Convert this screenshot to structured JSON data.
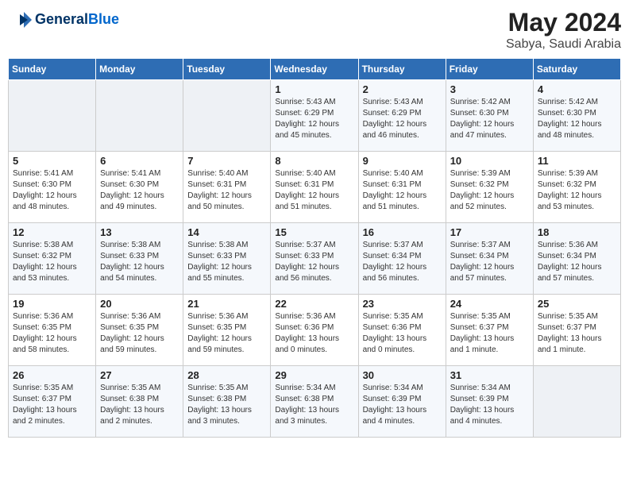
{
  "header": {
    "logo_line1": "General",
    "logo_line2": "Blue",
    "month_year": "May 2024",
    "location": "Sabya, Saudi Arabia"
  },
  "days_of_week": [
    "Sunday",
    "Monday",
    "Tuesday",
    "Wednesday",
    "Thursday",
    "Friday",
    "Saturday"
  ],
  "weeks": [
    [
      {
        "day": "",
        "info": ""
      },
      {
        "day": "",
        "info": ""
      },
      {
        "day": "",
        "info": ""
      },
      {
        "day": "1",
        "info": "Sunrise: 5:43 AM\nSunset: 6:29 PM\nDaylight: 12 hours\nand 45 minutes."
      },
      {
        "day": "2",
        "info": "Sunrise: 5:43 AM\nSunset: 6:29 PM\nDaylight: 12 hours\nand 46 minutes."
      },
      {
        "day": "3",
        "info": "Sunrise: 5:42 AM\nSunset: 6:30 PM\nDaylight: 12 hours\nand 47 minutes."
      },
      {
        "day": "4",
        "info": "Sunrise: 5:42 AM\nSunset: 6:30 PM\nDaylight: 12 hours\nand 48 minutes."
      }
    ],
    [
      {
        "day": "5",
        "info": "Sunrise: 5:41 AM\nSunset: 6:30 PM\nDaylight: 12 hours\nand 48 minutes."
      },
      {
        "day": "6",
        "info": "Sunrise: 5:41 AM\nSunset: 6:30 PM\nDaylight: 12 hours\nand 49 minutes."
      },
      {
        "day": "7",
        "info": "Sunrise: 5:40 AM\nSunset: 6:31 PM\nDaylight: 12 hours\nand 50 minutes."
      },
      {
        "day": "8",
        "info": "Sunrise: 5:40 AM\nSunset: 6:31 PM\nDaylight: 12 hours\nand 51 minutes."
      },
      {
        "day": "9",
        "info": "Sunrise: 5:40 AM\nSunset: 6:31 PM\nDaylight: 12 hours\nand 51 minutes."
      },
      {
        "day": "10",
        "info": "Sunrise: 5:39 AM\nSunset: 6:32 PM\nDaylight: 12 hours\nand 52 minutes."
      },
      {
        "day": "11",
        "info": "Sunrise: 5:39 AM\nSunset: 6:32 PM\nDaylight: 12 hours\nand 53 minutes."
      }
    ],
    [
      {
        "day": "12",
        "info": "Sunrise: 5:38 AM\nSunset: 6:32 PM\nDaylight: 12 hours\nand 53 minutes."
      },
      {
        "day": "13",
        "info": "Sunrise: 5:38 AM\nSunset: 6:33 PM\nDaylight: 12 hours\nand 54 minutes."
      },
      {
        "day": "14",
        "info": "Sunrise: 5:38 AM\nSunset: 6:33 PM\nDaylight: 12 hours\nand 55 minutes."
      },
      {
        "day": "15",
        "info": "Sunrise: 5:37 AM\nSunset: 6:33 PM\nDaylight: 12 hours\nand 56 minutes."
      },
      {
        "day": "16",
        "info": "Sunrise: 5:37 AM\nSunset: 6:34 PM\nDaylight: 12 hours\nand 56 minutes."
      },
      {
        "day": "17",
        "info": "Sunrise: 5:37 AM\nSunset: 6:34 PM\nDaylight: 12 hours\nand 57 minutes."
      },
      {
        "day": "18",
        "info": "Sunrise: 5:36 AM\nSunset: 6:34 PM\nDaylight: 12 hours\nand 57 minutes."
      }
    ],
    [
      {
        "day": "19",
        "info": "Sunrise: 5:36 AM\nSunset: 6:35 PM\nDaylight: 12 hours\nand 58 minutes."
      },
      {
        "day": "20",
        "info": "Sunrise: 5:36 AM\nSunset: 6:35 PM\nDaylight: 12 hours\nand 59 minutes."
      },
      {
        "day": "21",
        "info": "Sunrise: 5:36 AM\nSunset: 6:35 PM\nDaylight: 12 hours\nand 59 minutes."
      },
      {
        "day": "22",
        "info": "Sunrise: 5:36 AM\nSunset: 6:36 PM\nDaylight: 13 hours\nand 0 minutes."
      },
      {
        "day": "23",
        "info": "Sunrise: 5:35 AM\nSunset: 6:36 PM\nDaylight: 13 hours\nand 0 minutes."
      },
      {
        "day": "24",
        "info": "Sunrise: 5:35 AM\nSunset: 6:37 PM\nDaylight: 13 hours\nand 1 minute."
      },
      {
        "day": "25",
        "info": "Sunrise: 5:35 AM\nSunset: 6:37 PM\nDaylight: 13 hours\nand 1 minute."
      }
    ],
    [
      {
        "day": "26",
        "info": "Sunrise: 5:35 AM\nSunset: 6:37 PM\nDaylight: 13 hours\nand 2 minutes."
      },
      {
        "day": "27",
        "info": "Sunrise: 5:35 AM\nSunset: 6:38 PM\nDaylight: 13 hours\nand 2 minutes."
      },
      {
        "day": "28",
        "info": "Sunrise: 5:35 AM\nSunset: 6:38 PM\nDaylight: 13 hours\nand 3 minutes."
      },
      {
        "day": "29",
        "info": "Sunrise: 5:34 AM\nSunset: 6:38 PM\nDaylight: 13 hours\nand 3 minutes."
      },
      {
        "day": "30",
        "info": "Sunrise: 5:34 AM\nSunset: 6:39 PM\nDaylight: 13 hours\nand 4 minutes."
      },
      {
        "day": "31",
        "info": "Sunrise: 5:34 AM\nSunset: 6:39 PM\nDaylight: 13 hours\nand 4 minutes."
      },
      {
        "day": "",
        "info": ""
      }
    ]
  ]
}
